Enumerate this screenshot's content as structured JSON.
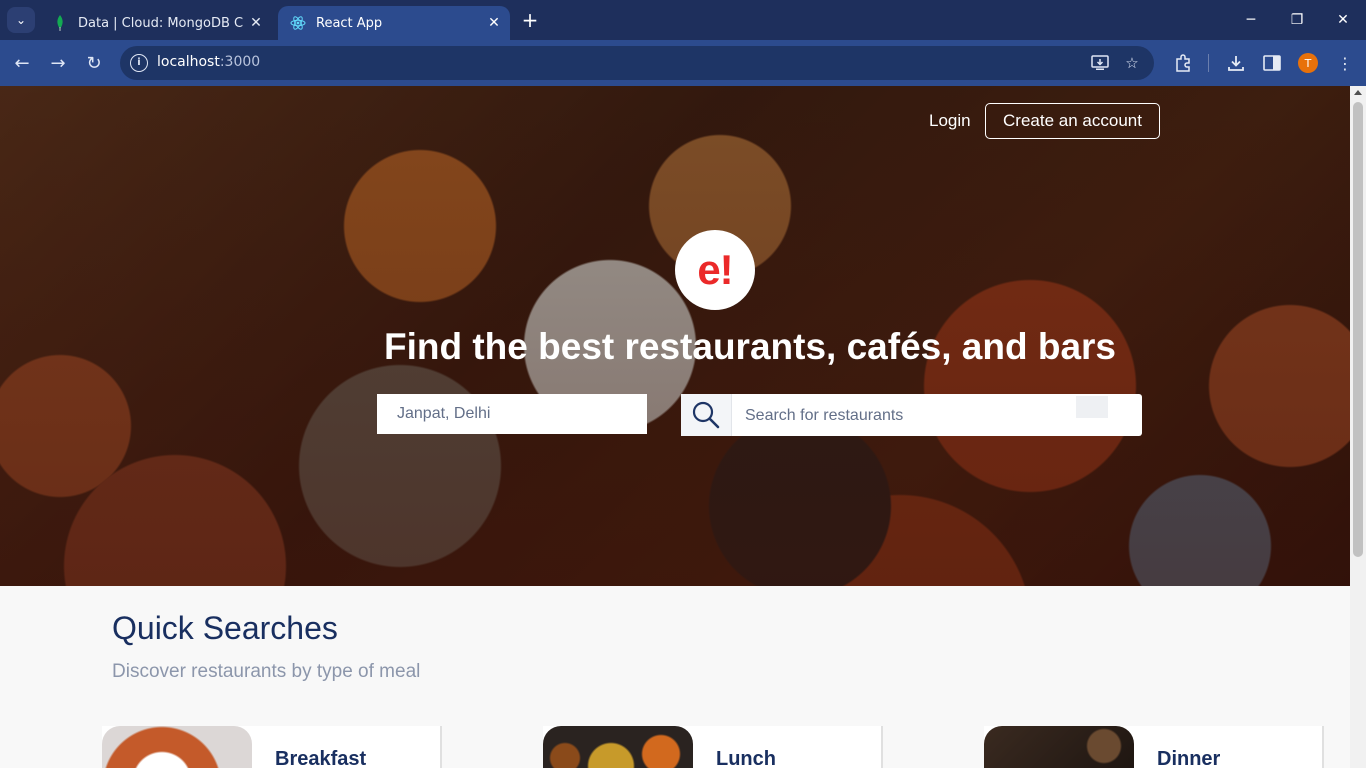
{
  "browser": {
    "tabs": [
      {
        "title": "Data | Cloud: MongoDB Cloud",
        "favicon": "mongodb-leaf-icon",
        "active": false
      },
      {
        "title": "React App",
        "favicon": "react-icon",
        "active": true
      }
    ],
    "address": {
      "host": "localhost",
      "port": ":3000"
    },
    "profile_initial": "T"
  },
  "header": {
    "login_label": "Login",
    "create_account_label": "Create an account"
  },
  "hero": {
    "logo_text": "e!",
    "headline": "Find the best restaurants, cafés, and bars",
    "location_value": "Janpat, Delhi",
    "search_placeholder": "Search for restaurants"
  },
  "quick_searches": {
    "title": "Quick Searches",
    "subtitle": "Discover restaurants by type of meal",
    "cards": [
      {
        "title": "Breakfast",
        "thumb_color": "#e7e2dc"
      },
      {
        "title": "Lunch",
        "thumb_color": "#2a2320"
      },
      {
        "title": "Dinner",
        "thumb_color": "#3a2a20"
      }
    ]
  },
  "colors": {
    "navy": "#192f60",
    "brand_red": "#eb2929",
    "chrome_dark": "#1e2f5c",
    "chrome_toolbar": "#2c4b8e"
  }
}
